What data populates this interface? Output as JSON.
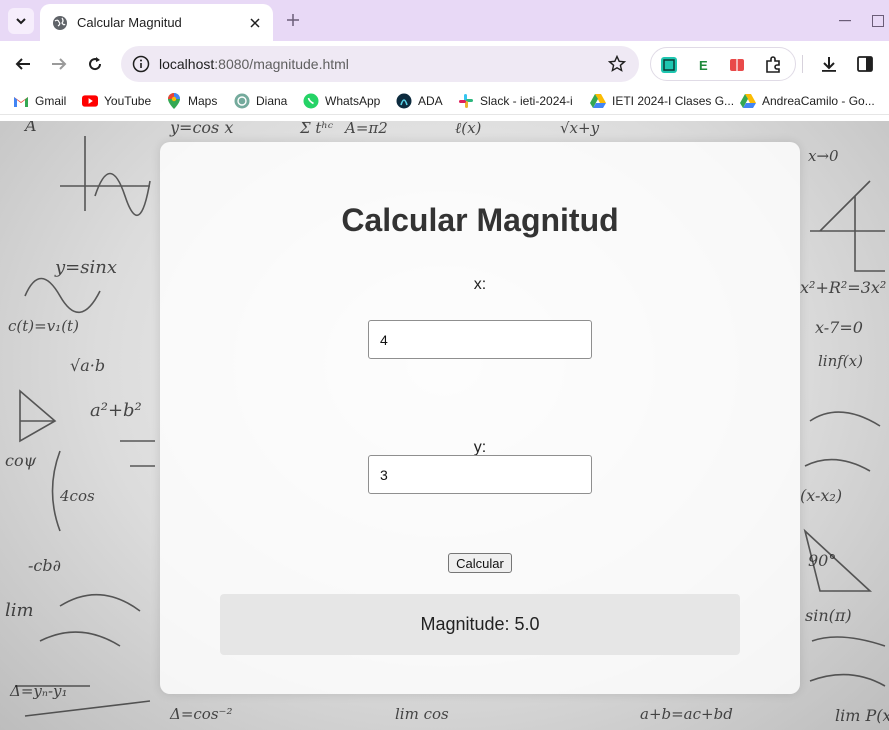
{
  "browser": {
    "tab": {
      "title": "Calcular Magnitud"
    },
    "url": {
      "host": "localhost",
      "rest": ":8080/magnitude.html"
    },
    "bookmarks": [
      {
        "label": "Gmail",
        "icon": "gmail-icon"
      },
      {
        "label": "YouTube",
        "icon": "youtube-icon"
      },
      {
        "label": "Maps",
        "icon": "maps-icon"
      },
      {
        "label": "Diana",
        "icon": "chatgpt-icon"
      },
      {
        "label": "WhatsApp",
        "icon": "whatsapp-icon"
      },
      {
        "label": "ADA",
        "icon": "ada-icon"
      },
      {
        "label": "Slack - ieti-2024-i",
        "icon": "slack-icon"
      },
      {
        "label": "IETI 2024-I Clases G...",
        "icon": "google-drive-icon"
      },
      {
        "label": "AndreaCamilo - Go...",
        "icon": "google-drive-icon"
      }
    ],
    "colors": {
      "tabbar": "#e8d9f6",
      "omnibox": "#efe9f4"
    }
  },
  "page": {
    "title": "Calcular Magnitud",
    "x_label": "x:",
    "x_value": "4",
    "y_label": "y:",
    "y_value": "3",
    "button_label": "Calcular",
    "result_text": "Magnitude: 5.0"
  }
}
